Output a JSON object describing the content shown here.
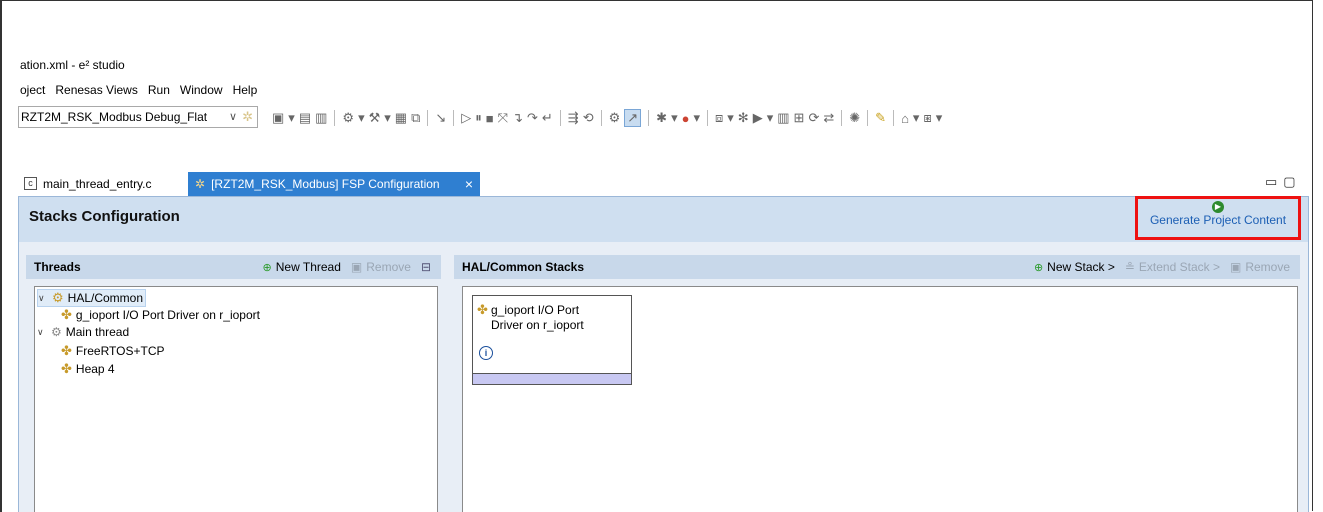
{
  "window": {
    "title": "ation.xml - e² studio"
  },
  "menu": [
    "oject",
    "Renesas Views",
    "Run",
    "Window",
    "Help"
  ],
  "launch_config": {
    "value": "RZT2M_RSK_Modbus Debug_Flat"
  },
  "tabs": [
    {
      "label": "main_thread_entry.c",
      "active": false
    },
    {
      "label": "[RZT2M_RSK_Modbus] FSP Configuration",
      "active": true
    }
  ],
  "stacks_config": {
    "title": "Stacks Configuration",
    "generate_label": "Generate Project Content"
  },
  "threads": {
    "header": "Threads",
    "new_thread": "New Thread",
    "remove": "Remove",
    "tree": [
      {
        "label": "HAL/Common",
        "level": 0,
        "expanded": true,
        "selected": true
      },
      {
        "label": "g_ioport I/O Port Driver on r_ioport",
        "level": 1
      },
      {
        "label": "Main thread",
        "level": 0,
        "expanded": true
      },
      {
        "label": "FreeRTOS+TCP",
        "level": 1
      },
      {
        "label": "Heap 4",
        "level": 1
      }
    ]
  },
  "stacks": {
    "header": "HAL/Common Stacks",
    "new_stack": "New Stack >",
    "extend_stack": "Extend Stack >",
    "remove": "Remove",
    "card": {
      "line1": "g_ioport I/O Port",
      "line2": "Driver on r_ioport"
    }
  },
  "colors": {
    "accent_tab": "#2f7fd1",
    "highlight_border": "#e11111",
    "header_bg": "#cfdff0"
  }
}
